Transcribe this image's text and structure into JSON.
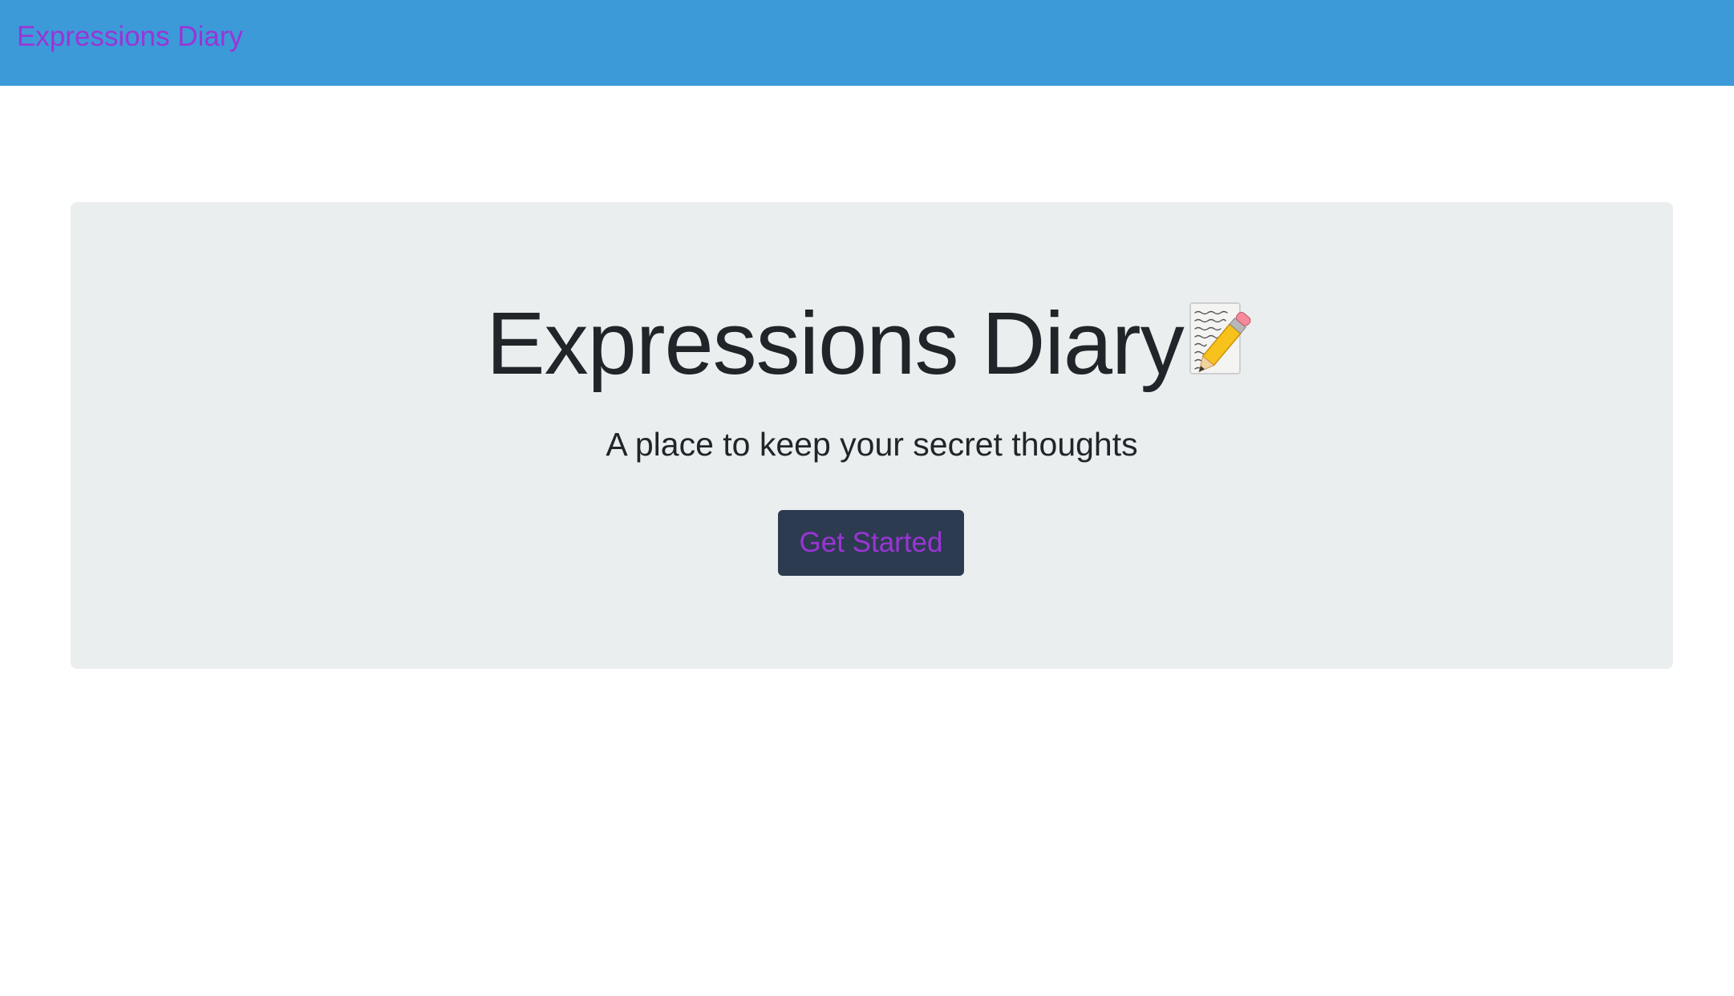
{
  "navbar": {
    "brand": "Expressions Diary"
  },
  "hero": {
    "title": "Expressions Diary",
    "title_icon": "memo-pencil-icon",
    "subtitle": "A place to keep your secret thoughts",
    "cta_label": "Get Started"
  },
  "colors": {
    "navbar_bg": "#3c9ad9",
    "brand_text": "#9b34d6",
    "jumbotron_bg": "#ebeeef",
    "button_bg": "#2c3b50",
    "button_text": "#9b34d6",
    "heading_text": "#212529"
  }
}
